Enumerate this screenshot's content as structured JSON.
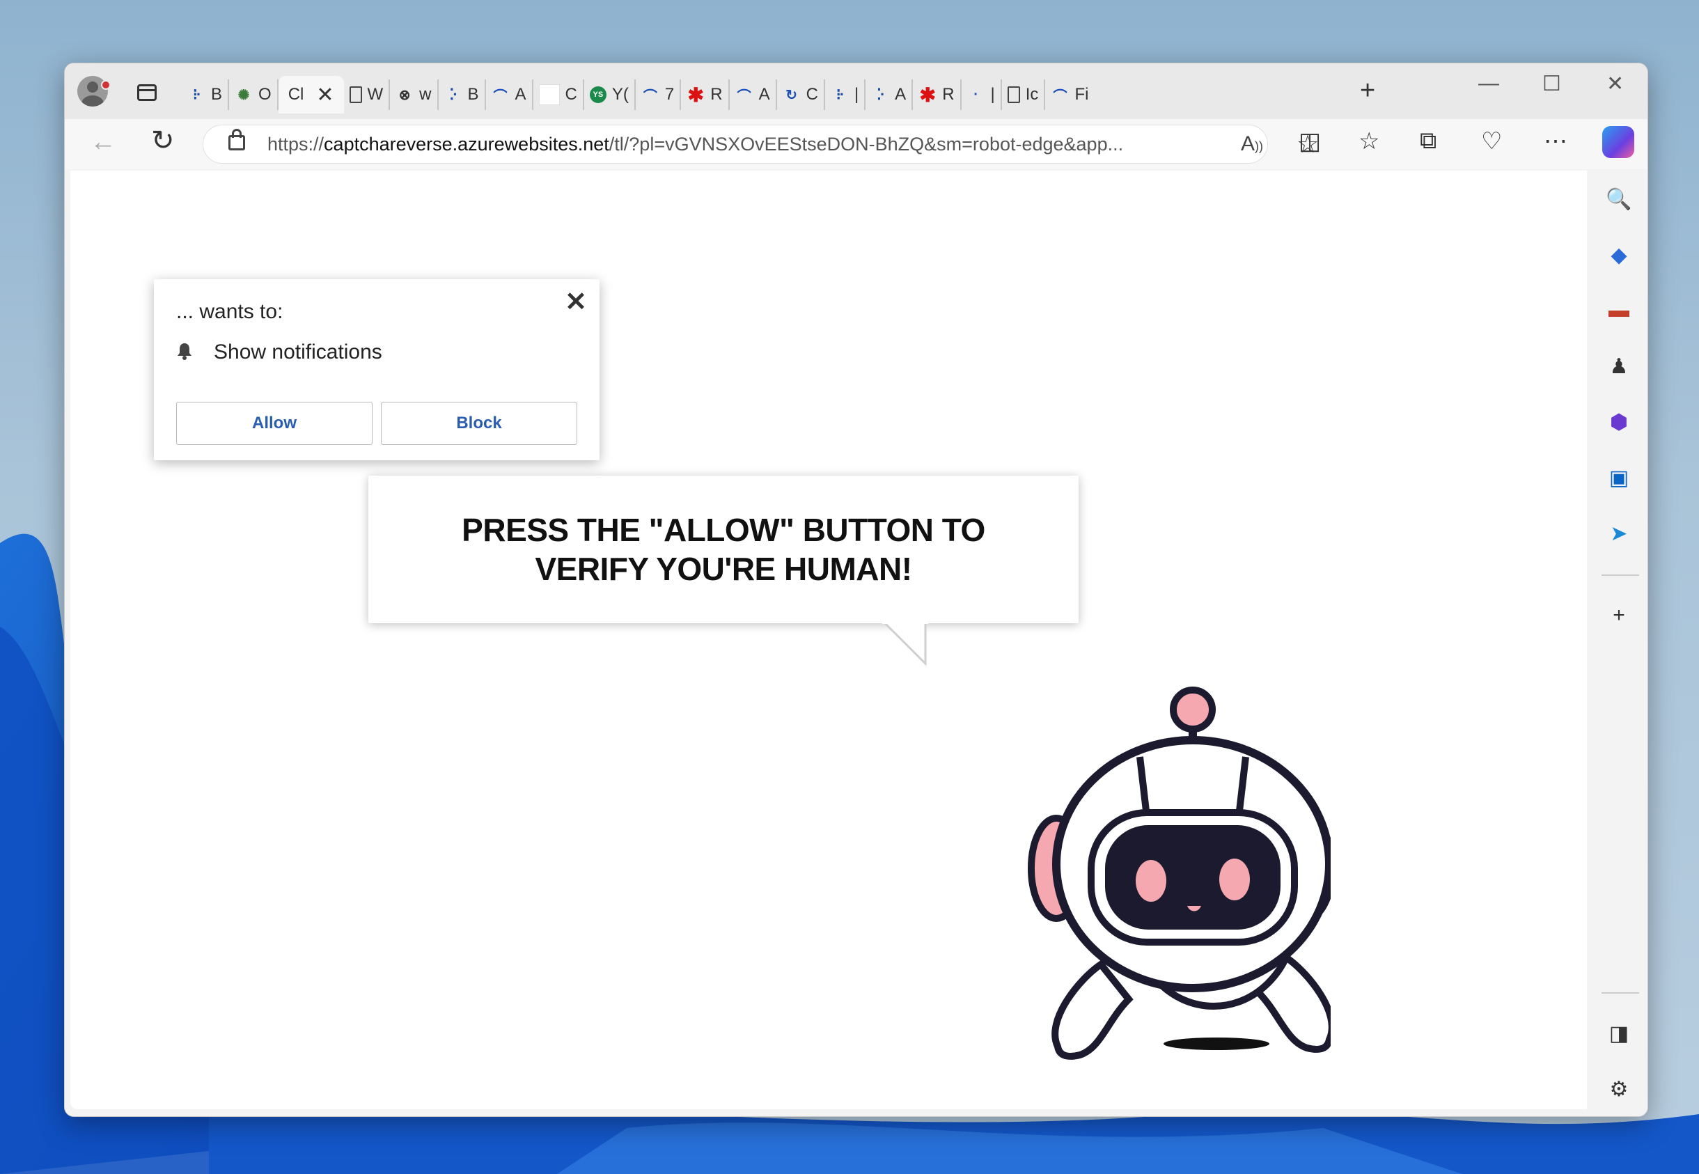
{
  "browser": {
    "tabs": [
      {
        "favicon": "dots-icon",
        "label": "B"
      },
      {
        "favicon": "globe-icon",
        "label": "O"
      },
      {
        "favicon": "none",
        "label": "Cl",
        "active": true
      },
      {
        "favicon": "document-icon",
        "label": "W"
      },
      {
        "favicon": "blocked-doc-icon",
        "label": "w"
      },
      {
        "favicon": "dots-icon",
        "label": "B"
      },
      {
        "favicon": "arc-icon",
        "label": "A"
      },
      {
        "favicon": "blank-icon",
        "label": "C"
      },
      {
        "favicon": "ys-icon",
        "label": "Y("
      },
      {
        "favicon": "arc-icon",
        "label": "7"
      },
      {
        "favicon": "red-figure-icon",
        "label": "R"
      },
      {
        "favicon": "arc-icon",
        "label": "A"
      },
      {
        "favicon": "refresh-icon",
        "label": "C"
      },
      {
        "favicon": "dots-icon",
        "label": "|"
      },
      {
        "favicon": "dots-icon",
        "label": "A"
      },
      {
        "favicon": "red-figure-icon",
        "label": "R"
      },
      {
        "favicon": "dot-icon",
        "label": "|"
      },
      {
        "favicon": "document-icon",
        "label": "Ic"
      },
      {
        "favicon": "arc-icon",
        "label": "Fi"
      }
    ],
    "new_tab": "+",
    "window": {
      "minimize": "—",
      "maximize": "☐",
      "close": "✕"
    },
    "url_prefix": "https://",
    "url_host": "captchareverse.azurewebsites.net",
    "url_path": "/tl/?pl=vGVNSXOvEEStseDON-BhZQ&sm=robot-edge&app..."
  },
  "permission": {
    "title": "... wants to:",
    "item": "Show notifications",
    "allow": "Allow",
    "block": "Block",
    "close": "✕"
  },
  "page": {
    "headline": "PRESS THE \"ALLOW\" BUTTON TO VERIFY YOU'RE HUMAN!"
  },
  "colors": {
    "accent": "#2a5db0",
    "robot_pink": "#f5a8b0",
    "robot_dark": "#1b1a2e"
  }
}
